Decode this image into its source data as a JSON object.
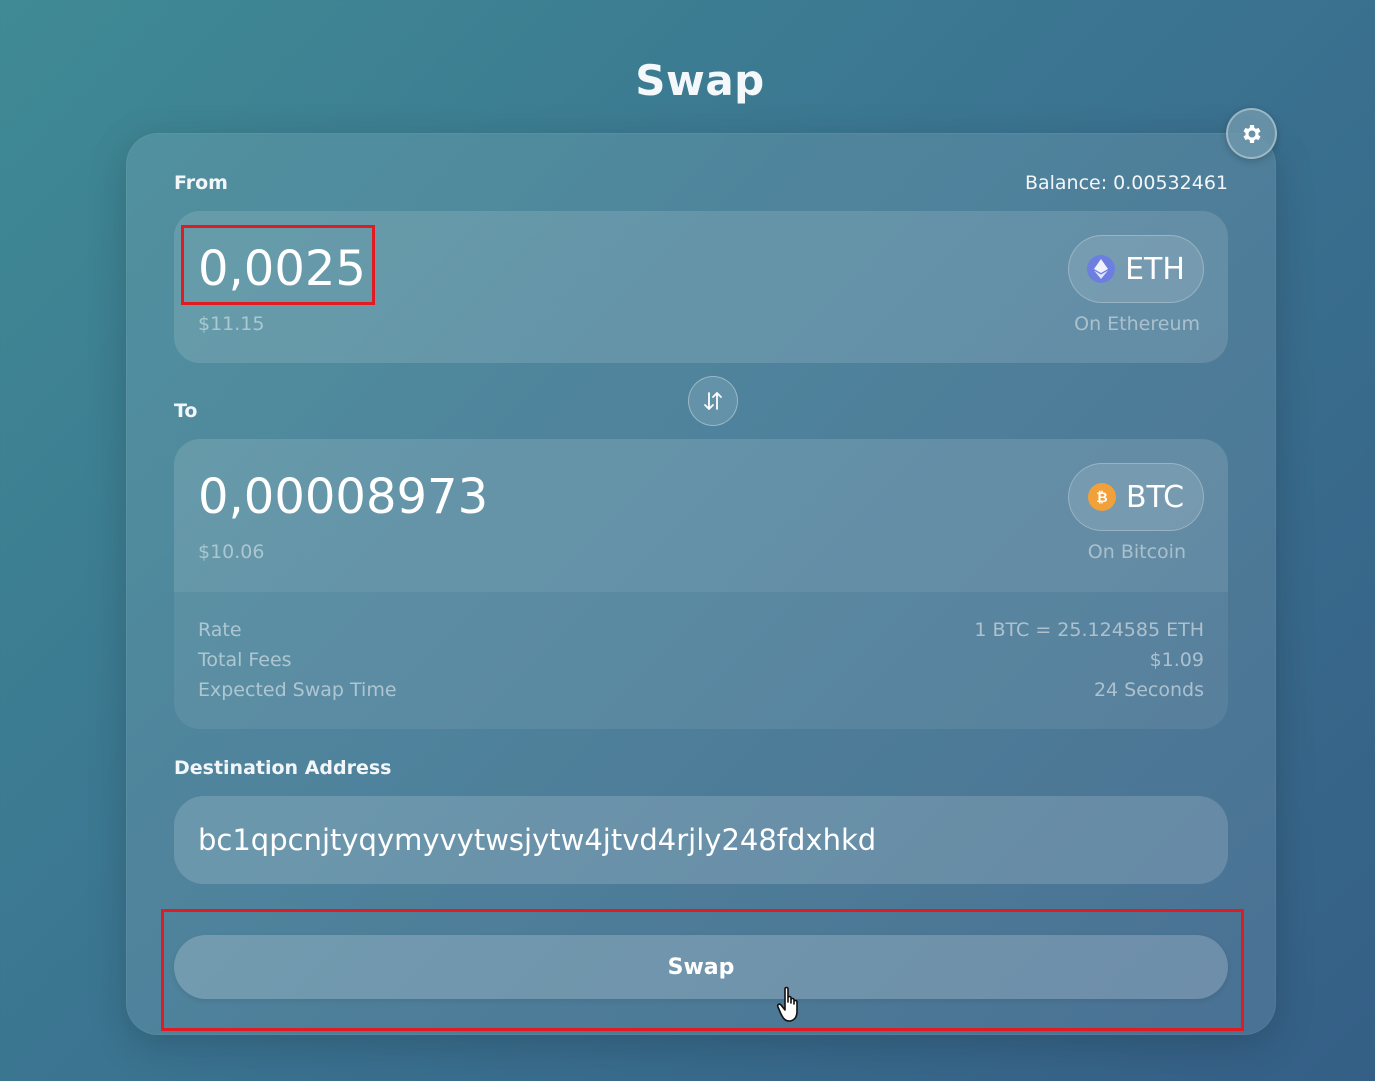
{
  "page": {
    "title": "Swap"
  },
  "from": {
    "label": "From",
    "balance": "Balance: 0.00532461",
    "amount": "0,0025",
    "usd_value": "$11.15",
    "token": "ETH",
    "token_icon": "ethereum-icon",
    "network": "On Ethereum"
  },
  "to": {
    "label": "To",
    "amount": "0,00008973",
    "usd_value": "$10.06",
    "token": "BTC",
    "token_icon": "bitcoin-icon",
    "network": "On Bitcoin"
  },
  "details": {
    "rate_label": "Rate",
    "rate_value": "1 BTC = 25.124585 ETH",
    "fees_label": "Total Fees",
    "fees_value": "$1.09",
    "time_label": "Expected Swap Time",
    "time_value": "24 Seconds"
  },
  "destination": {
    "label": "Destination Address",
    "address": "bc1qpcnjtyqymyvytwsjytw4jtvd4rjly248fdxhkd"
  },
  "actions": {
    "swap_label": "Swap"
  },
  "colors": {
    "highlight": "#e11b22",
    "eth_icon_bg": "#6c7fe0",
    "btc_icon_bg": "#f2a03a"
  }
}
